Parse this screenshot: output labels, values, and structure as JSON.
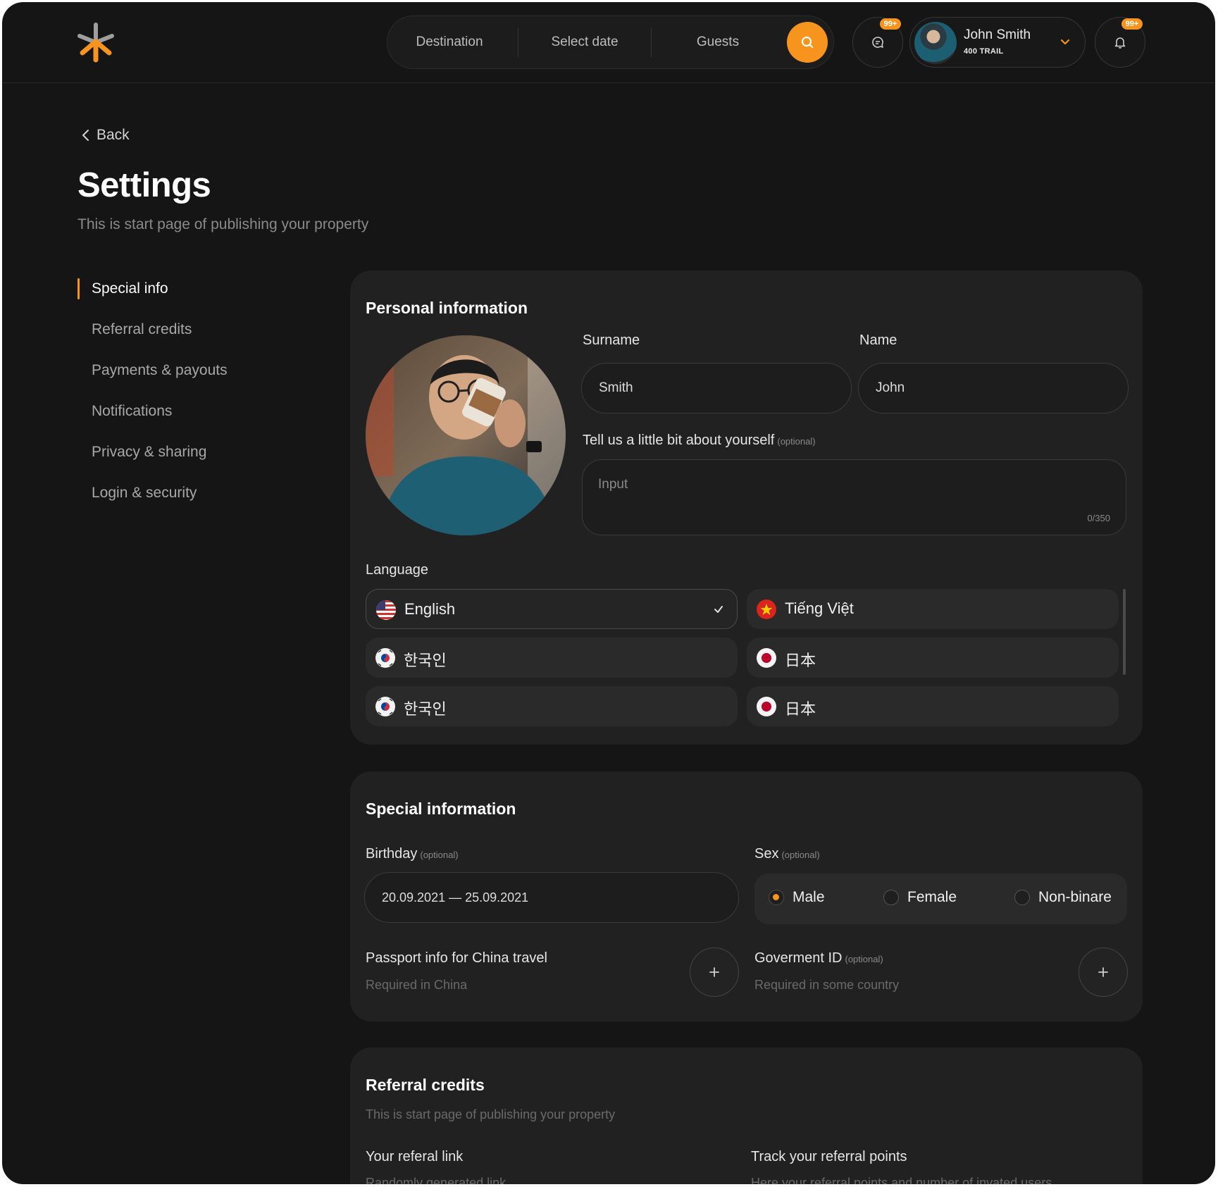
{
  "header": {
    "search": {
      "destination": "Destination",
      "date": "Select date",
      "guests": "Guests"
    },
    "messages_badge": "99+",
    "notifications_badge": "99+",
    "user": {
      "name": "John Smith",
      "subtitle": "400 TRAIL"
    }
  },
  "page": {
    "back_label": "Back",
    "title": "Settings",
    "subtitle": "This is start page of publishing your property"
  },
  "sidenav": {
    "items": [
      {
        "label": "Special info",
        "active": true
      },
      {
        "label": "Referral credits"
      },
      {
        "label": "Payments & payouts"
      },
      {
        "label": "Notifications"
      },
      {
        "label": "Privacy & sharing"
      },
      {
        "label": "Login & security"
      }
    ]
  },
  "personal": {
    "title": "Personal information",
    "surname_label": "Surname",
    "surname_value": "Smith",
    "name_label": "Name",
    "name_value": "John",
    "about_label": "Tell us a little bit about yourself",
    "about_optional": "(optional)",
    "about_placeholder": "Input",
    "about_count": "0/350",
    "language_label": "Language",
    "languages": [
      {
        "label": "English",
        "flag": "us-flag",
        "selected": true
      },
      {
        "label": "Tiếng Việt",
        "flag": "vn-flag"
      },
      {
        "label": "한국인",
        "flag": "kr-flag"
      },
      {
        "label": "日本",
        "flag": "jp-flag"
      },
      {
        "label": "한국인",
        "flag": "kr-flag"
      },
      {
        "label": "日本",
        "flag": "jp-flag"
      }
    ]
  },
  "special": {
    "title": "Special information",
    "birthday_label": "Birthday",
    "birthday_optional": "(optional)",
    "birthday_value": "20.09.2021 — 25.09.2021",
    "sex_label": "Sex",
    "sex_optional": "(optional)",
    "sex_options": [
      "Male",
      "Female",
      "Non-binare"
    ],
    "sex_selected": "Male",
    "passport_label": "Passport info for China travel",
    "passport_helper": "Required in China",
    "gov_label": "Goverment ID",
    "gov_optional": "(optional)",
    "gov_helper": "Required in some country"
  },
  "referral": {
    "title": "Referral credits",
    "subtitle": "This is start page of publishing your property",
    "link_label": "Your referal link",
    "link_helper": "Randomly generated link",
    "track_label": "Track your referral points",
    "track_helper": "Here your referral points and number of invated users"
  },
  "colors": {
    "accent": "#f7941d",
    "background": "#151515",
    "card": "#212121"
  }
}
